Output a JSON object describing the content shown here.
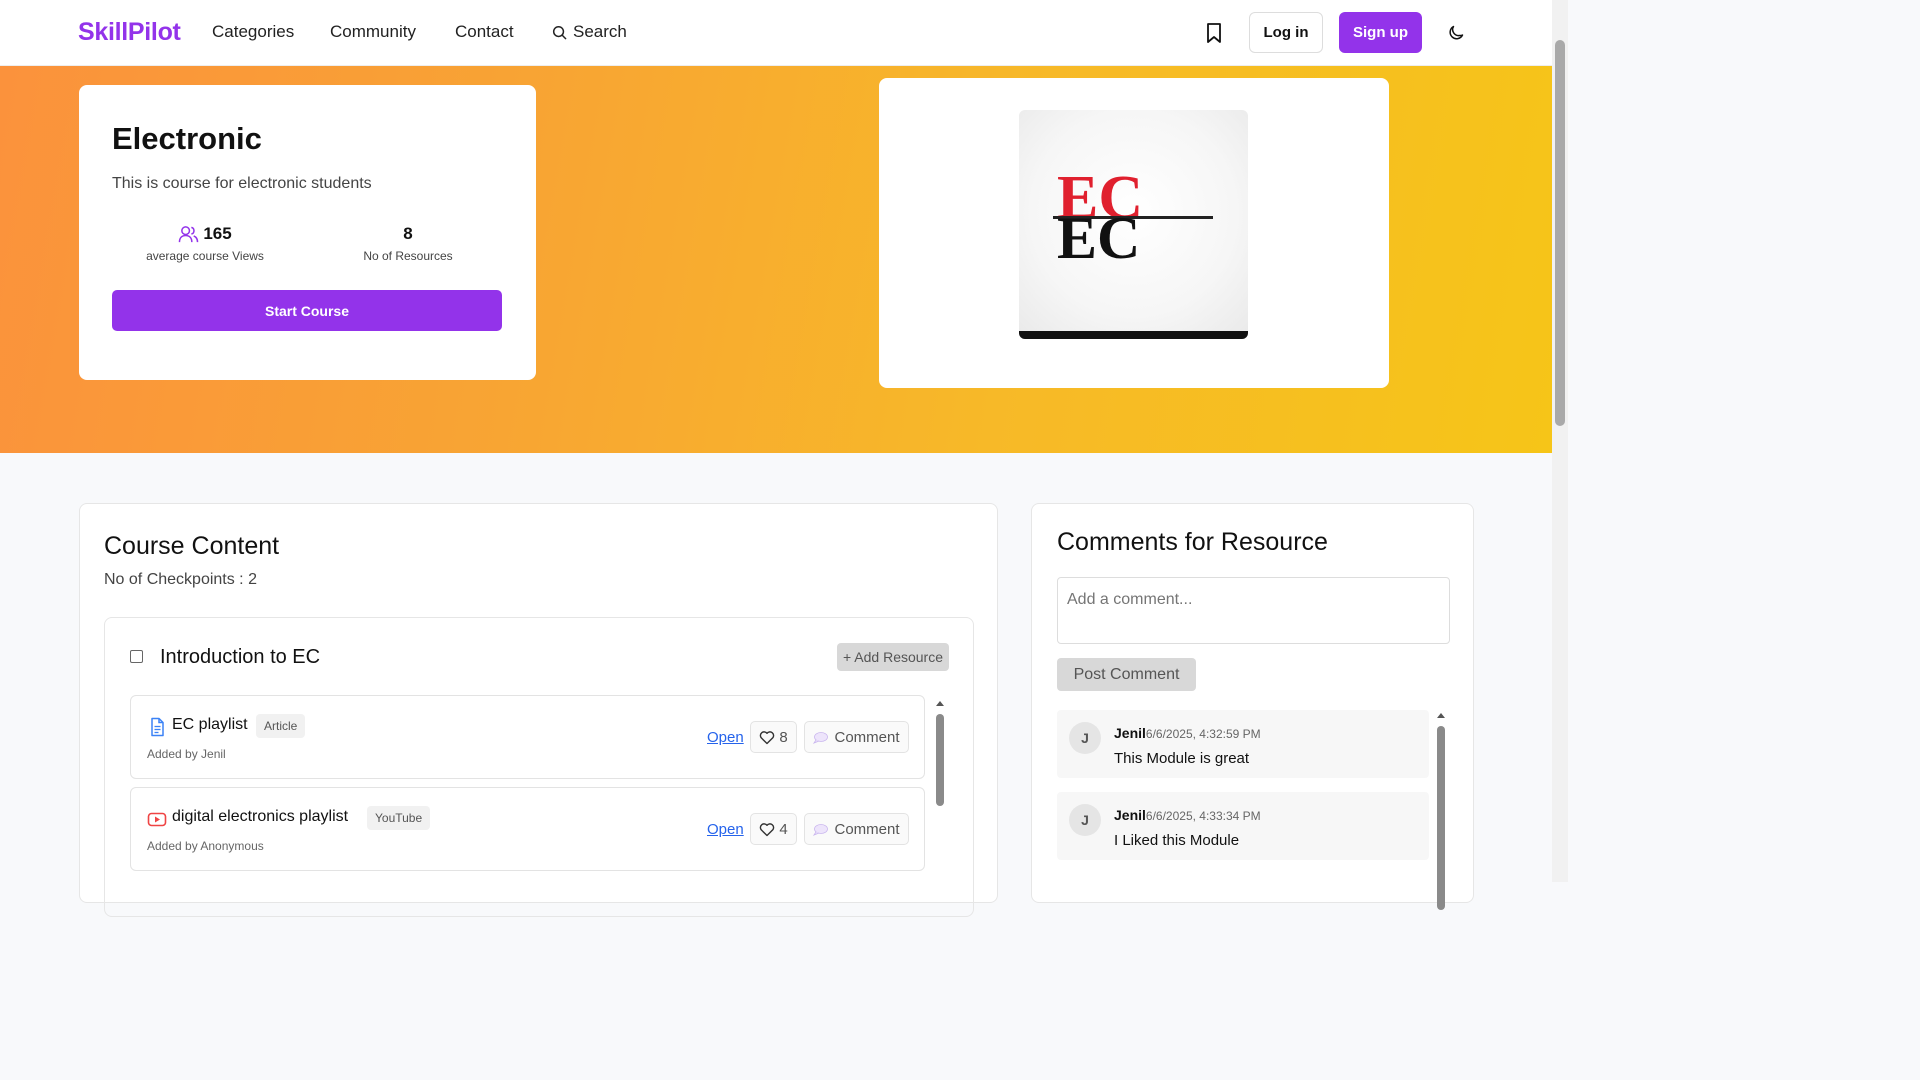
{
  "nav": {
    "logo": "SkillPilot",
    "links": [
      "Categories",
      "Community",
      "Contact"
    ],
    "search": "Search",
    "login": "Log in",
    "signup": "Sign up"
  },
  "course": {
    "title": "Electronic",
    "description": "This is course for electronic students",
    "views_value": "165",
    "views_label": "average course Views",
    "resources_value": "8",
    "resources_label": "No of Resources",
    "start_button": "Start Course",
    "image_text": "EC"
  },
  "content": {
    "title": "Course Content",
    "checkpoints": "No of Checkpoints : 2",
    "module": {
      "title": "Introduction to EC",
      "add_resource": "+ Add Resource",
      "resources": [
        {
          "title": "EC playlist",
          "tag": "Article",
          "added_by": "Added by Jenil",
          "open": "Open",
          "likes": "8",
          "comment": "Comment",
          "icon": "document-icon"
        },
        {
          "title": "digital electronics playlist",
          "tag": "YouTube",
          "added_by": "Added by Anonymous",
          "open": "Open",
          "likes": "4",
          "comment": "Comment",
          "icon": "youtube-icon"
        }
      ]
    }
  },
  "comments": {
    "title": "Comments for Resource",
    "placeholder": "Add a comment...",
    "post_button": "Post Comment",
    "items": [
      {
        "avatar": "J",
        "author": "Jenil",
        "time": "6/6/2025, 4:32:59 PM",
        "text": "This Module is great"
      },
      {
        "avatar": "J",
        "author": "Jenil",
        "time": "6/6/2025, 4:33:34 PM",
        "text": "I Liked this Module"
      }
    ]
  },
  "colors": {
    "brand": "#9333ea",
    "hero_start": "#fb923c",
    "hero_end": "#f6c518",
    "link": "#2563eb"
  }
}
